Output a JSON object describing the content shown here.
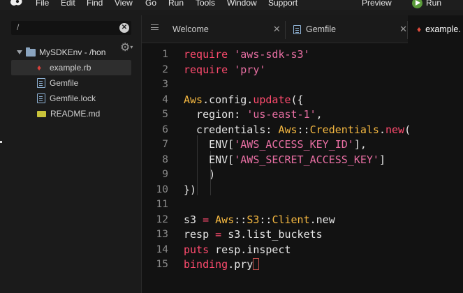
{
  "menubar": {
    "items": [
      "File",
      "Edit",
      "Find",
      "View",
      "Go",
      "Run",
      "Tools",
      "Window",
      "Support"
    ],
    "preview": "Preview",
    "run": "Run"
  },
  "sidebar": {
    "search_value": "/",
    "clear_symbol": "✕",
    "root_name": "MySDKEnv",
    "root_path": " - /hon",
    "files": [
      {
        "name": "example.rb",
        "icon": "ruby-icon",
        "active": true
      },
      {
        "name": "Gemfile",
        "icon": "document-icon"
      },
      {
        "name": "Gemfile.lock",
        "icon": "document-icon"
      },
      {
        "name": "README.md",
        "icon": "markdown-icon"
      }
    ]
  },
  "tabs": [
    {
      "label": "Welcome",
      "icon": "hamburger-icon",
      "close": "✕"
    },
    {
      "label": "Gemfile",
      "icon": "document-icon",
      "close": "✕"
    },
    {
      "label": "example.",
      "icon": "ruby-icon",
      "active": true
    }
  ],
  "editor": {
    "line_numbers": [
      "1",
      "2",
      "3",
      "4",
      "5",
      "6",
      "7",
      "8",
      "9",
      "10",
      "11",
      "12",
      "13",
      "14",
      "15"
    ],
    "colors": {
      "keyword": "#ff4b6e",
      "string": "#e86fa3",
      "constant": "#f5b841",
      "text": "#e6e6e6"
    }
  }
}
